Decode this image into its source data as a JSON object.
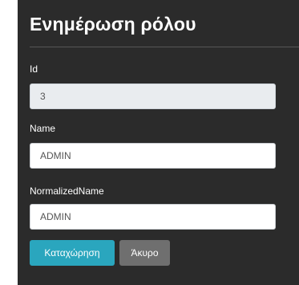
{
  "form": {
    "title": "Ενημέρωση ρόλου",
    "fields": [
      {
        "label": "Id",
        "value": "3",
        "readonly": true
      },
      {
        "label": "Name",
        "value": "ADMIN",
        "readonly": false
      },
      {
        "label": "NormalizedName",
        "value": "ADMIN",
        "readonly": false
      }
    ],
    "submit_label": "Καταχώρηση",
    "cancel_label": "Άκυρο"
  },
  "colors": {
    "panel_background": "#2b2b2b",
    "primary_button": "#2aa6be",
    "secondary_button": "#6f6f6f",
    "readonly_field": "#e9ecef"
  }
}
